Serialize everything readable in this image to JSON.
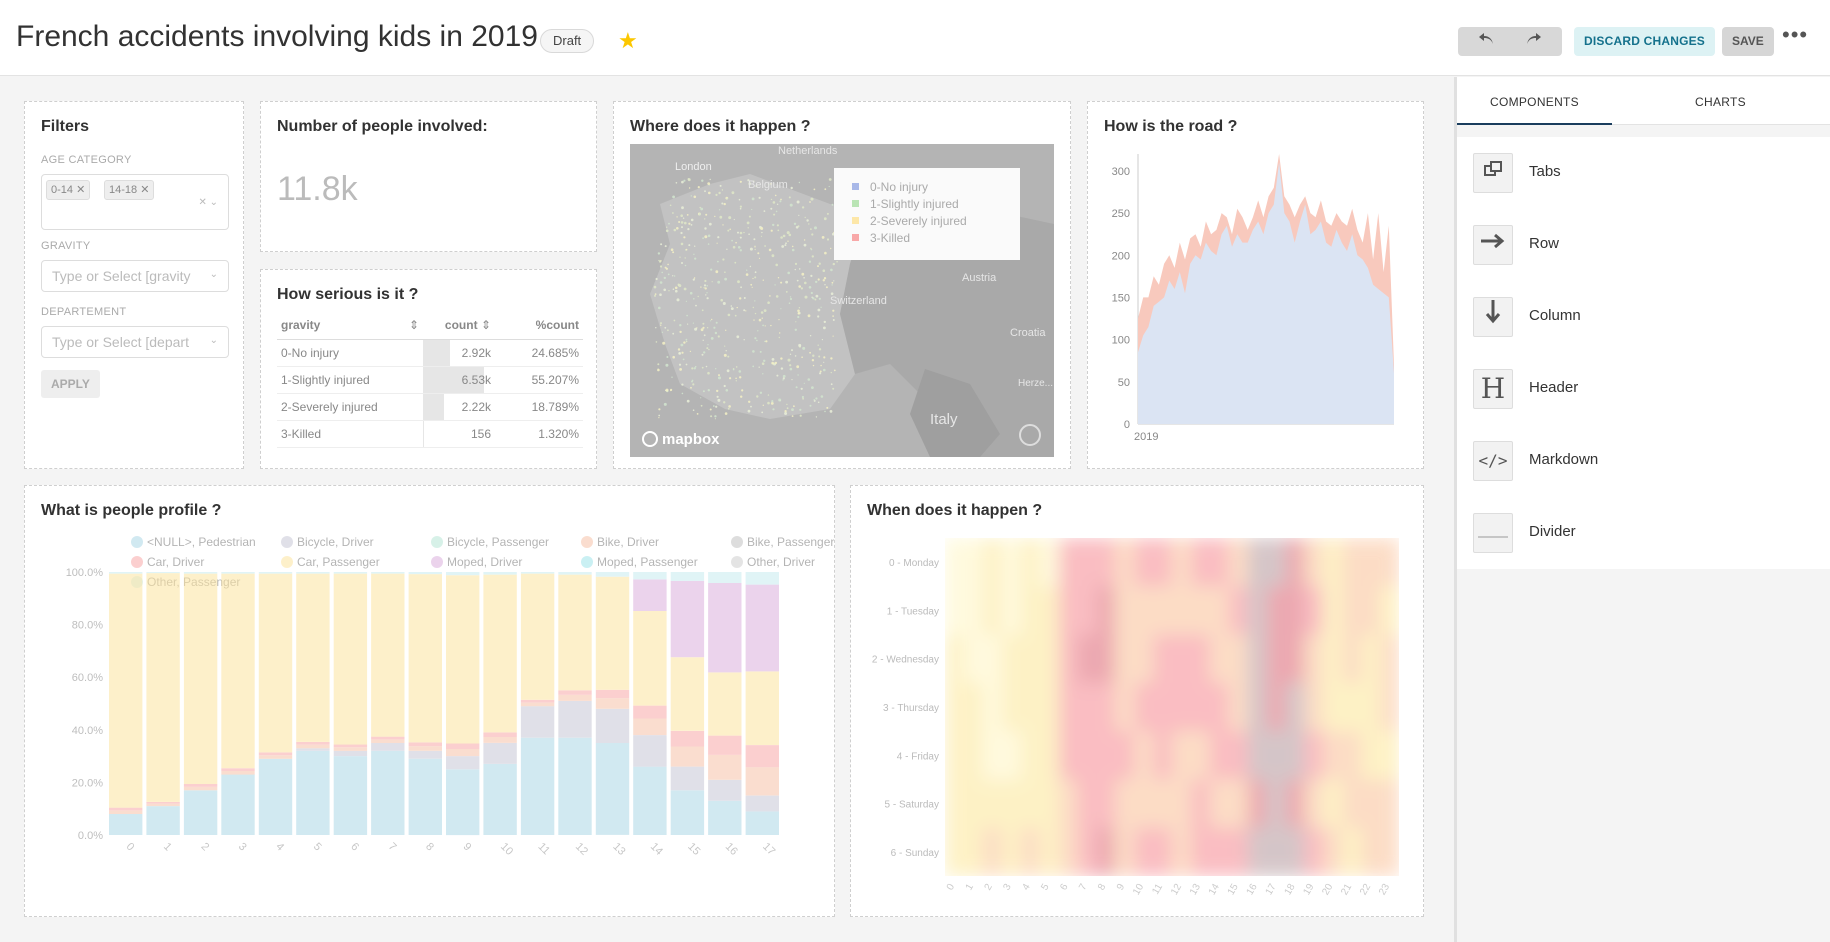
{
  "header": {
    "title": "French accidents involving kids in 2019",
    "badge": "Draft",
    "discard_label": "DISCARD CHANGES",
    "save_label": "SAVE"
  },
  "filters": {
    "title": "Filters",
    "age_label": "AGE CATEGORY",
    "age_tags": [
      "0-14",
      "14-18"
    ],
    "gravity_label": "GRAVITY",
    "gravity_placeholder": "Type or Select [gravity",
    "department_label": "DEPARTEMENT",
    "department_placeholder": "Type or Select [depart",
    "apply_label": "APPLY"
  },
  "people": {
    "title": "Number of people involved:",
    "value": "11.8k"
  },
  "serious": {
    "title": "How serious is it ?",
    "columns": [
      "gravity",
      "count",
      "%count"
    ],
    "rows": [
      {
        "gravity": "0-No injury",
        "count": "2.92k",
        "pct": "24.685%",
        "share": 0.247
      },
      {
        "gravity": "1-Slightly injured",
        "count": "6.53k",
        "pct": "55.207%",
        "share": 0.552
      },
      {
        "gravity": "2-Severely injured",
        "count": "2.22k",
        "pct": "18.789%",
        "share": 0.188
      },
      {
        "gravity": "3-Killed",
        "count": "156",
        "pct": "1.320%",
        "share": 0.013
      }
    ]
  },
  "map": {
    "title": "Where does it happen ?",
    "legend": [
      "0-No injury",
      "1-Slightly injured",
      "2-Severely injured",
      "3-Killed"
    ],
    "legend_colors": [
      "#a8b8e8",
      "#b9e4b4",
      "#fde7a8",
      "#f8a8a8"
    ],
    "places": [
      "London",
      "Netherlands",
      "Belgium",
      "Switzerland",
      "Austria",
      "Croatia",
      "Italy",
      "Herze..."
    ],
    "attribution": "mapbox"
  },
  "road": {
    "title": "How is the road ?",
    "chart_data": {
      "type": "area",
      "x_tick": "2019",
      "yticks": [
        0,
        50,
        100,
        150,
        200,
        250,
        300
      ],
      "ylim": [
        0,
        320
      ],
      "series": [
        {
          "values": [
            85,
            105,
            115,
            140,
            145,
            150,
            170,
            160,
            180,
            155,
            190,
            200,
            195,
            215,
            205,
            200,
            225,
            235,
            210,
            225,
            215,
            215,
            230,
            240,
            225,
            250,
            260,
            310,
            250,
            240,
            215,
            240,
            260,
            225,
            230,
            240,
            215,
            210,
            230,
            215,
            205,
            225,
            200,
            195,
            185,
            165,
            160,
            155,
            150,
            60
          ]
        },
        {
          "values": [
            125,
            150,
            150,
            175,
            165,
            190,
            200,
            185,
            215,
            195,
            220,
            225,
            210,
            240,
            225,
            230,
            250,
            245,
            225,
            255,
            245,
            230,
            245,
            265,
            245,
            270,
            280,
            320,
            270,
            260,
            245,
            260,
            270,
            250,
            245,
            265,
            240,
            235,
            250,
            240,
            235,
            255,
            230,
            215,
            250,
            195,
            250,
            180,
            235,
            70
          ]
        }
      ],
      "colors": [
        "#dbe4f3",
        "#f8c9bd"
      ]
    }
  },
  "profile": {
    "title": "What is people profile ?",
    "chart_data": {
      "type": "bar",
      "legend": [
        "<NULL>, Pedestrian",
        "Bicycle, Driver",
        "Bicycle, Passenger",
        "Bike, Driver",
        "Bike, Passenger",
        "Car, Driver",
        "Car, Passenger",
        "Moped, Driver",
        "Moped, Passenger",
        "Other, Driver",
        "Other, Passenger"
      ],
      "colors": [
        "#add8e6",
        "#c8c8d6",
        "#b8e6d6",
        "#f6c3a8",
        "#c2c2c2",
        "#f8a8a8",
        "#fde5a0",
        "#dbb0dd",
        "#9fe4ea",
        "#cfcfcf",
        "#c7ecf0"
      ],
      "yticks": [
        "0.0%",
        "20.0%",
        "40.0%",
        "60.0%",
        "80.0%",
        "100.0%"
      ],
      "categories": [
        "0",
        "1",
        "2",
        "3",
        "4",
        "5",
        "6",
        "7",
        "8",
        "9",
        "10",
        "11",
        "12",
        "13",
        "14",
        "15",
        "16",
        "17"
      ],
      "pedestrian": [
        8,
        11,
        17,
        23,
        29,
        32,
        30,
        32,
        29,
        25,
        27,
        37,
        37,
        35,
        26,
        17,
        13,
        9
      ],
      "bicycle_driver": [
        0,
        0,
        0,
        0,
        0,
        1,
        2,
        3,
        3,
        5,
        8,
        12,
        14,
        13,
        12,
        9,
        8,
        6
      ],
      "car_passenger": [
        89,
        87,
        80,
        74,
        68,
        64,
        65,
        62,
        64,
        64,
        60,
        48,
        44,
        43,
        36,
        28,
        24,
        28
      ],
      "moped_driver": [
        0,
        0,
        0,
        0,
        0,
        0,
        0,
        0,
        0,
        0,
        0,
        0,
        0,
        0,
        12,
        29,
        34,
        33
      ]
    }
  },
  "when": {
    "title": "When does it happen ?",
    "chart_data": {
      "type": "heatmap",
      "ylabels": [
        "0 - Monday",
        "1 - Tuesday",
        "2 - Wednesday",
        "3 - Thursday",
        "4 - Friday",
        "5 - Saturday",
        "6 - Sunday"
      ],
      "xlabels": [
        "0",
        "1",
        "2",
        "3",
        "4",
        "5",
        "6",
        "7",
        "8",
        "9",
        "10",
        "11",
        "12",
        "13",
        "14",
        "15",
        "16",
        "17",
        "18",
        "19",
        "20",
        "21",
        "22",
        "23"
      ]
    }
  },
  "side": {
    "tabs": [
      "COMPONENTS",
      "CHARTS"
    ],
    "items": [
      "Tabs",
      "Row",
      "Column",
      "Header",
      "Markdown",
      "Divider"
    ]
  }
}
